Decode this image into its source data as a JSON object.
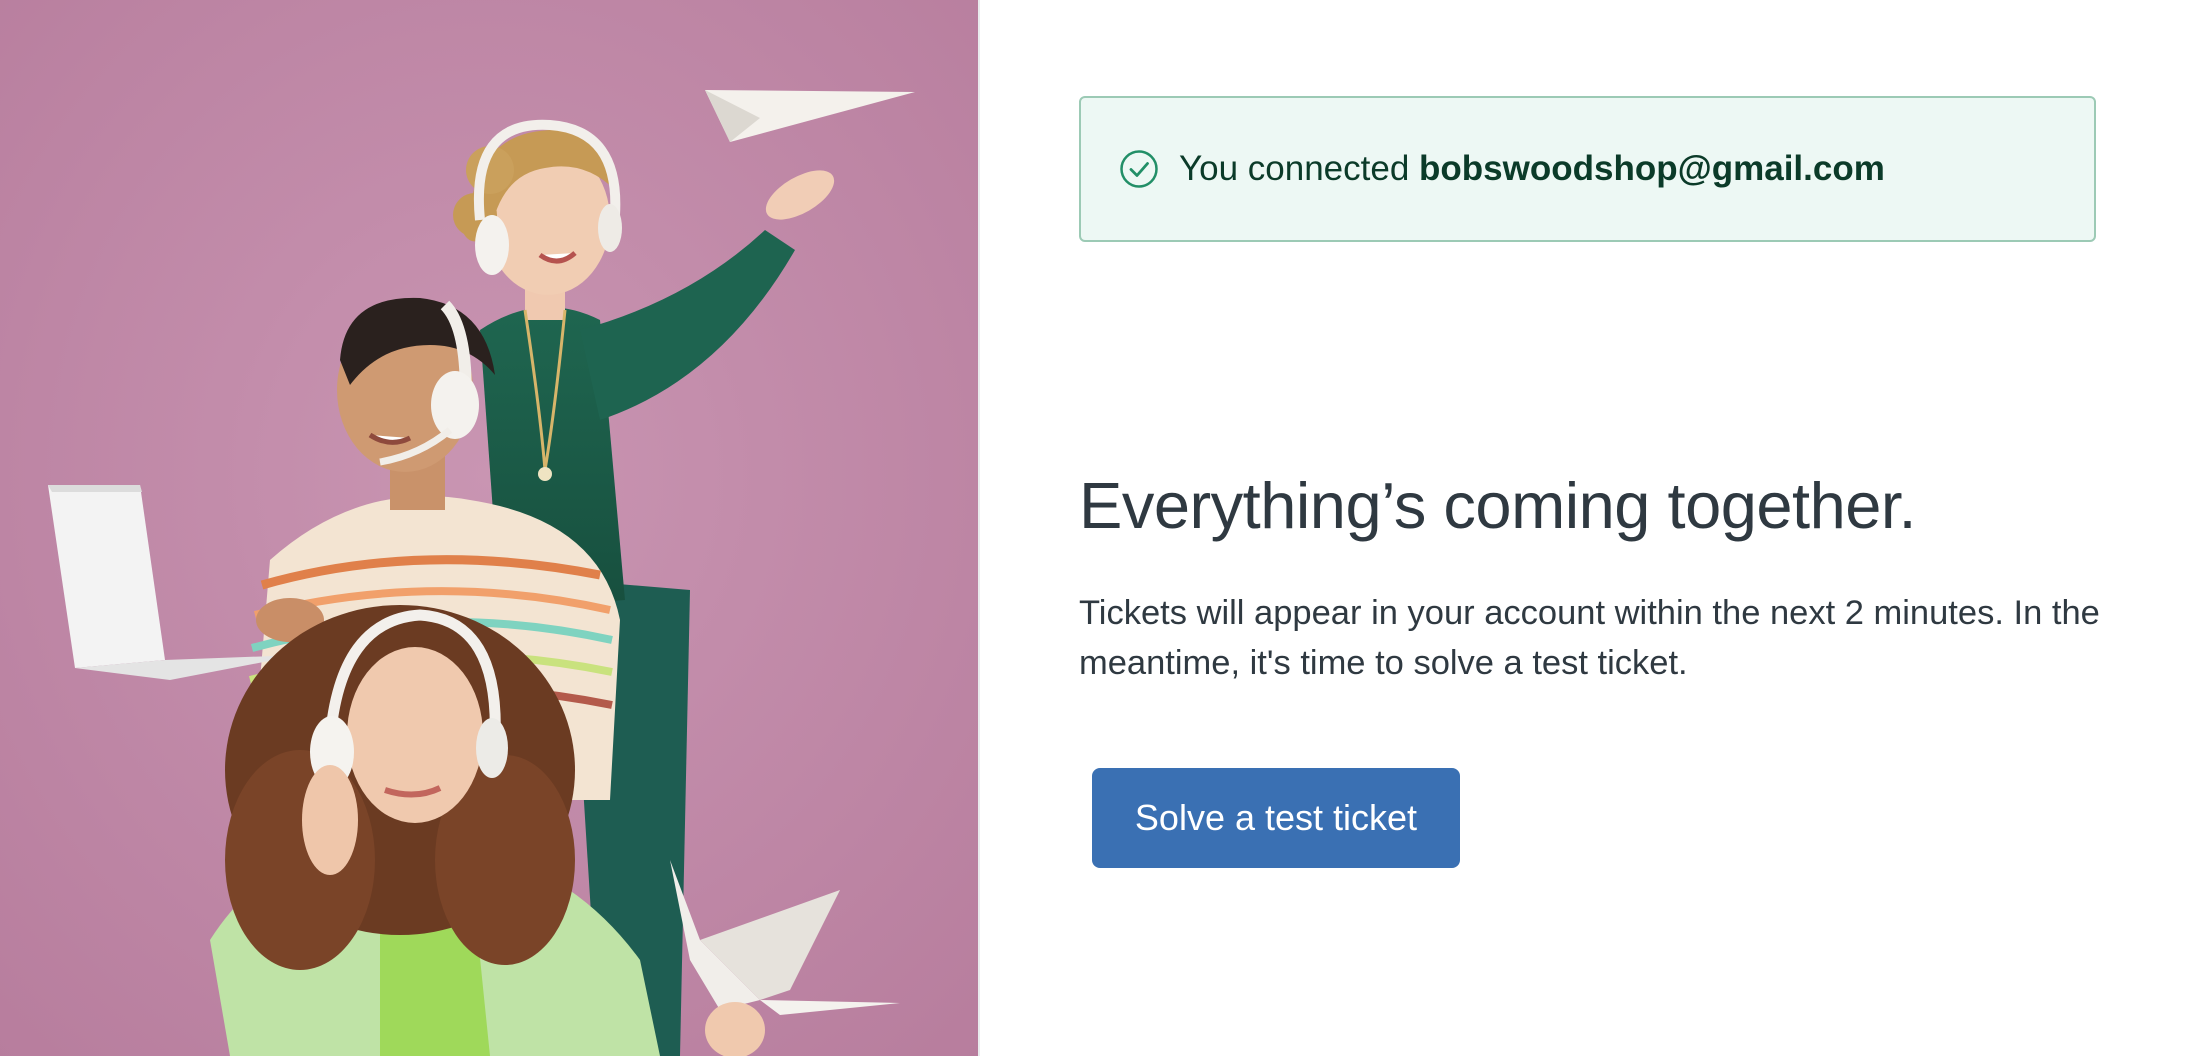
{
  "hero": {
    "image_alt": "Three smiling support agents wearing headsets with a laptop, paper plane and paper crane on a pink background",
    "background_color": "#c18aa8"
  },
  "notice": {
    "icon": "check-circle-icon",
    "prefix": "You connected ",
    "email": "bobswoodshop@gmail.com",
    "background_color": "#edf8f4",
    "border_color": "#9ccab5",
    "icon_color": "#228f67"
  },
  "main": {
    "headline": "Everything’s coming together.",
    "body": "Tickets will appear in your account within the next 2 minutes. In the meantime, it's time to solve a test ticket.",
    "cta_label": "Solve a test ticket",
    "cta_color": "#3a70b3"
  }
}
